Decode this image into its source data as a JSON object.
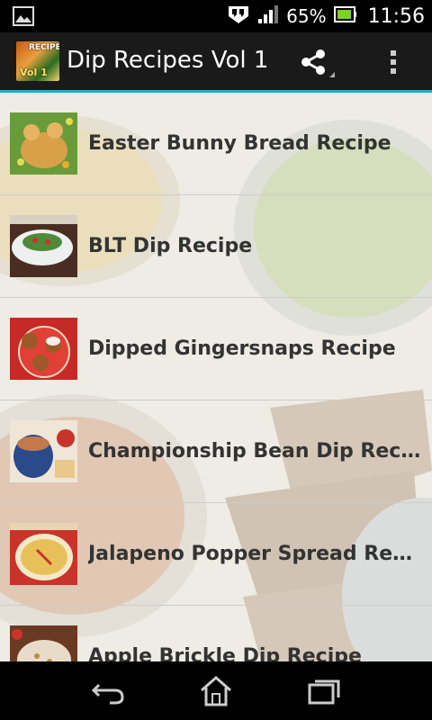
{
  "status_bar": {
    "battery_percent": "65%",
    "time": "11:56",
    "icons": [
      "image-notification-icon",
      "hangouts-icon",
      "signal-icon",
      "battery-icon"
    ]
  },
  "action_bar": {
    "title": "Dip Recipes Vol 1",
    "app_icon_text": "Vol 1",
    "app_icon_top": "RECIPES",
    "share_icon": "share-icon",
    "overflow_icon": "overflow-menu-icon",
    "accent_color": "#2aa6d8"
  },
  "recipes": [
    {
      "title": "Easter Bunny Bread Recipe"
    },
    {
      "title": "BLT Dip Recipe"
    },
    {
      "title": "Dipped Gingersnaps Recipe"
    },
    {
      "title": "Championship Bean Dip Reci..."
    },
    {
      "title": "Jalapeno Popper Spread Rec..."
    },
    {
      "title": "Apple Brickle Dip Recipe"
    }
  ],
  "nav_bar": {
    "icons": [
      "back-icon",
      "home-icon",
      "recent-apps-icon"
    ]
  }
}
